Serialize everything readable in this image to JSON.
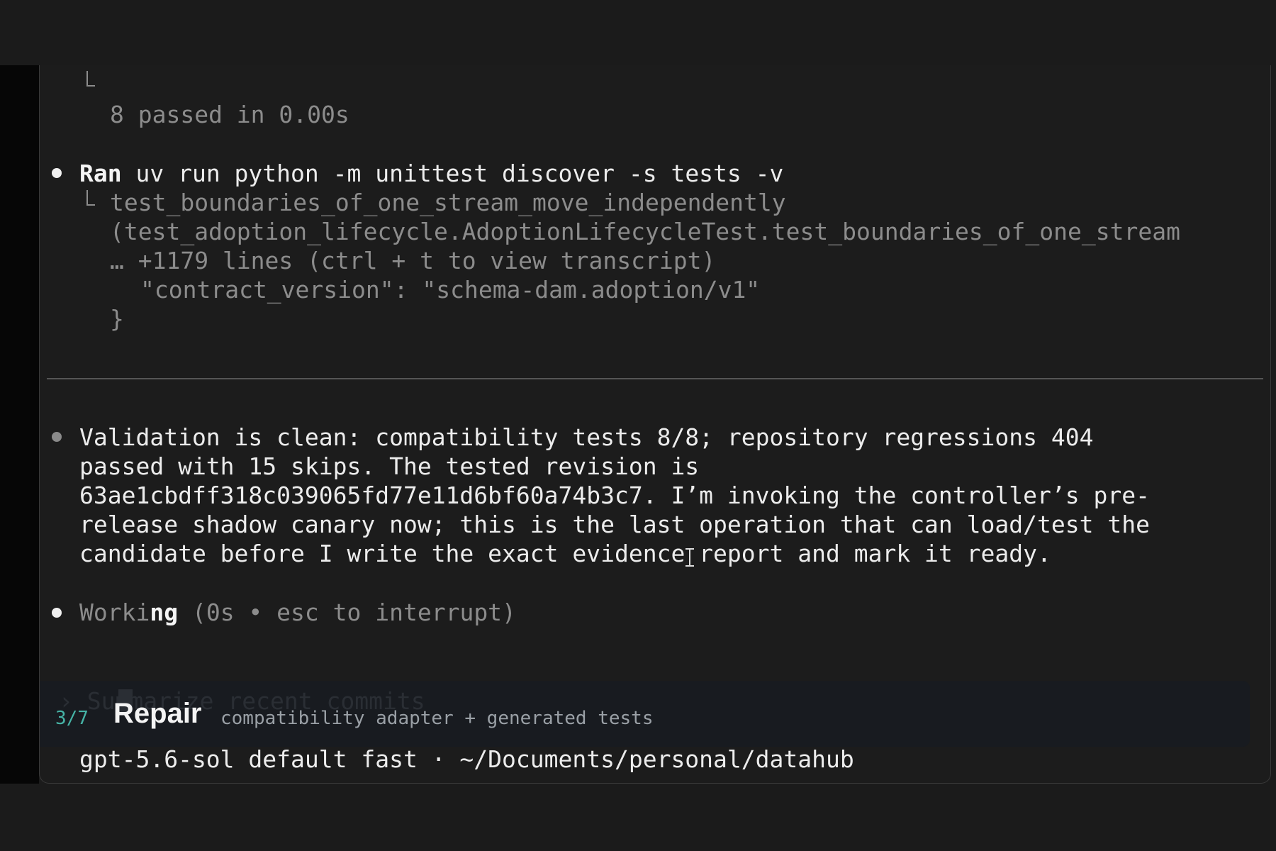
{
  "terminal": {
    "prev_result": "8 passed in 0.00s",
    "command": {
      "verb": "Ran",
      "text": " uv run python -m unittest discover -s tests -v",
      "output_line1": "test_boundaries_of_one_stream_move_independently",
      "output_line2": "(test_adoption_lifecycle.AdoptionLifecycleTest.test_boundaries_of_one_stream",
      "truncated": "… +1179 lines (ctrl + t to view transcript)",
      "json_line": "\"contract_version\": \"schema-dam.adoption/v1\"",
      "json_close": "}"
    },
    "message": {
      "lines": [
        "Validation is clean: compatibility tests 8/8; repository regressions 404",
        "passed with 15 skips. The tested revision is",
        "63ae1cbdff318c039065fd77e11d6bf60a74b3c7. I’m invoking the controller’s pre-",
        "release shadow canary now; this is the last operation that can load/test the",
        "candidate before I write the exact evidence report and mark it ready."
      ]
    },
    "working": {
      "dim_prefix": "Worki",
      "bright_part": "ng",
      "detail": " (0s • esc to interrupt)"
    }
  },
  "composer": {
    "faint_placeholder": "› Summarize recent commits",
    "step": "3/7",
    "stage": "Repair",
    "stage_desc": "compatibility adapter + generated tests"
  },
  "footer": {
    "model_info": "gpt-5.6-sol default fast · ~/Documents/personal/datahub"
  },
  "colors": {
    "background": "#1c1c1c",
    "accent": "#3bb7a8",
    "dim_text": "#8c8c8c",
    "bright_text": "#ececec"
  }
}
